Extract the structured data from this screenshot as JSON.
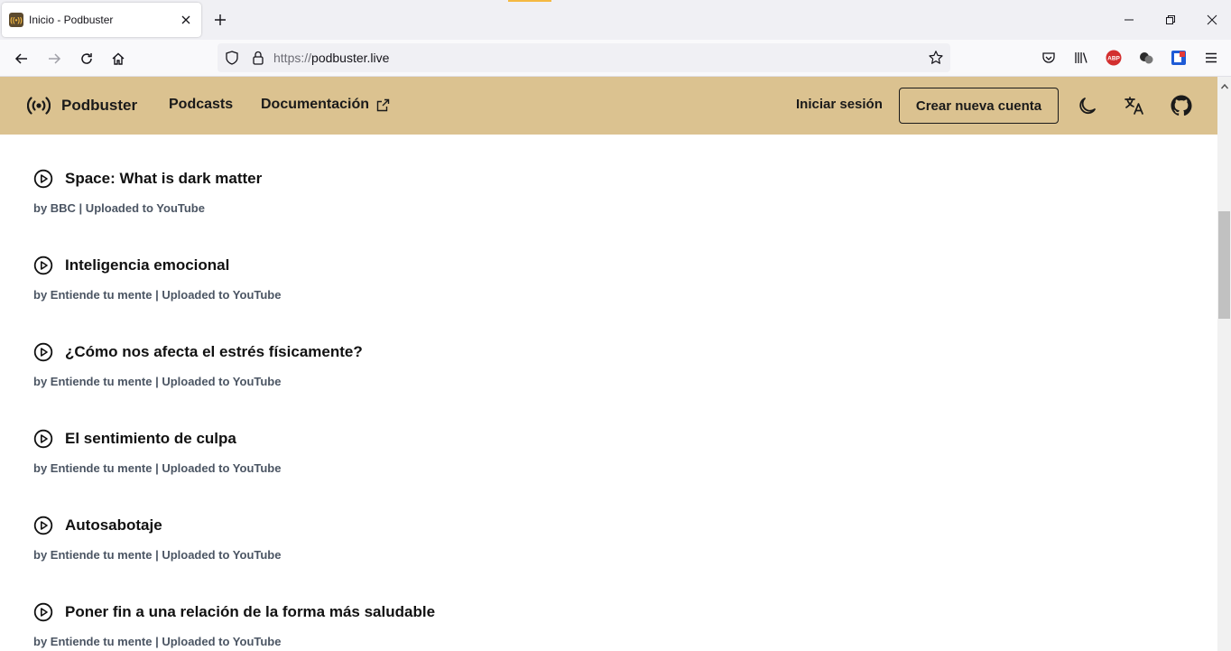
{
  "browser": {
    "tab_title": "Inicio - Podbuster",
    "url_protocol": "https://",
    "url_host": "podbuster.live"
  },
  "header": {
    "brand": "Podbuster",
    "nav_podcasts": "Podcasts",
    "nav_docs": "Documentación",
    "signin": "Iniciar sesión",
    "create_account": "Crear nueva cuenta",
    "icons": [
      "broadcast-icon",
      "external-link-icon",
      "moon-icon",
      "translate-icon",
      "github-icon"
    ]
  },
  "episodes": [
    {
      "title": "Space: What is dark matter",
      "meta": "by BBC | Uploaded to YouTube"
    },
    {
      "title": "Inteligencia emocional",
      "meta": "by Entiende tu mente | Uploaded to YouTube"
    },
    {
      "title": "¿Cómo nos afecta el estrés físicamente?",
      "meta": "by Entiende tu mente | Uploaded to YouTube"
    },
    {
      "title": "El sentimiento de culpa",
      "meta": "by Entiende tu mente | Uploaded to YouTube"
    },
    {
      "title": "Autosabotaje",
      "meta": "by Entiende tu mente | Uploaded to YouTube"
    },
    {
      "title": "Poner fin a una relación de la forma más saludable",
      "meta": "by Entiende tu mente | Uploaded to YouTube"
    }
  ],
  "colors": {
    "header_bg": "#dbc290",
    "text_dark": "#111111",
    "meta_text": "#4b5563",
    "adblock_red": "#d32f2f"
  }
}
